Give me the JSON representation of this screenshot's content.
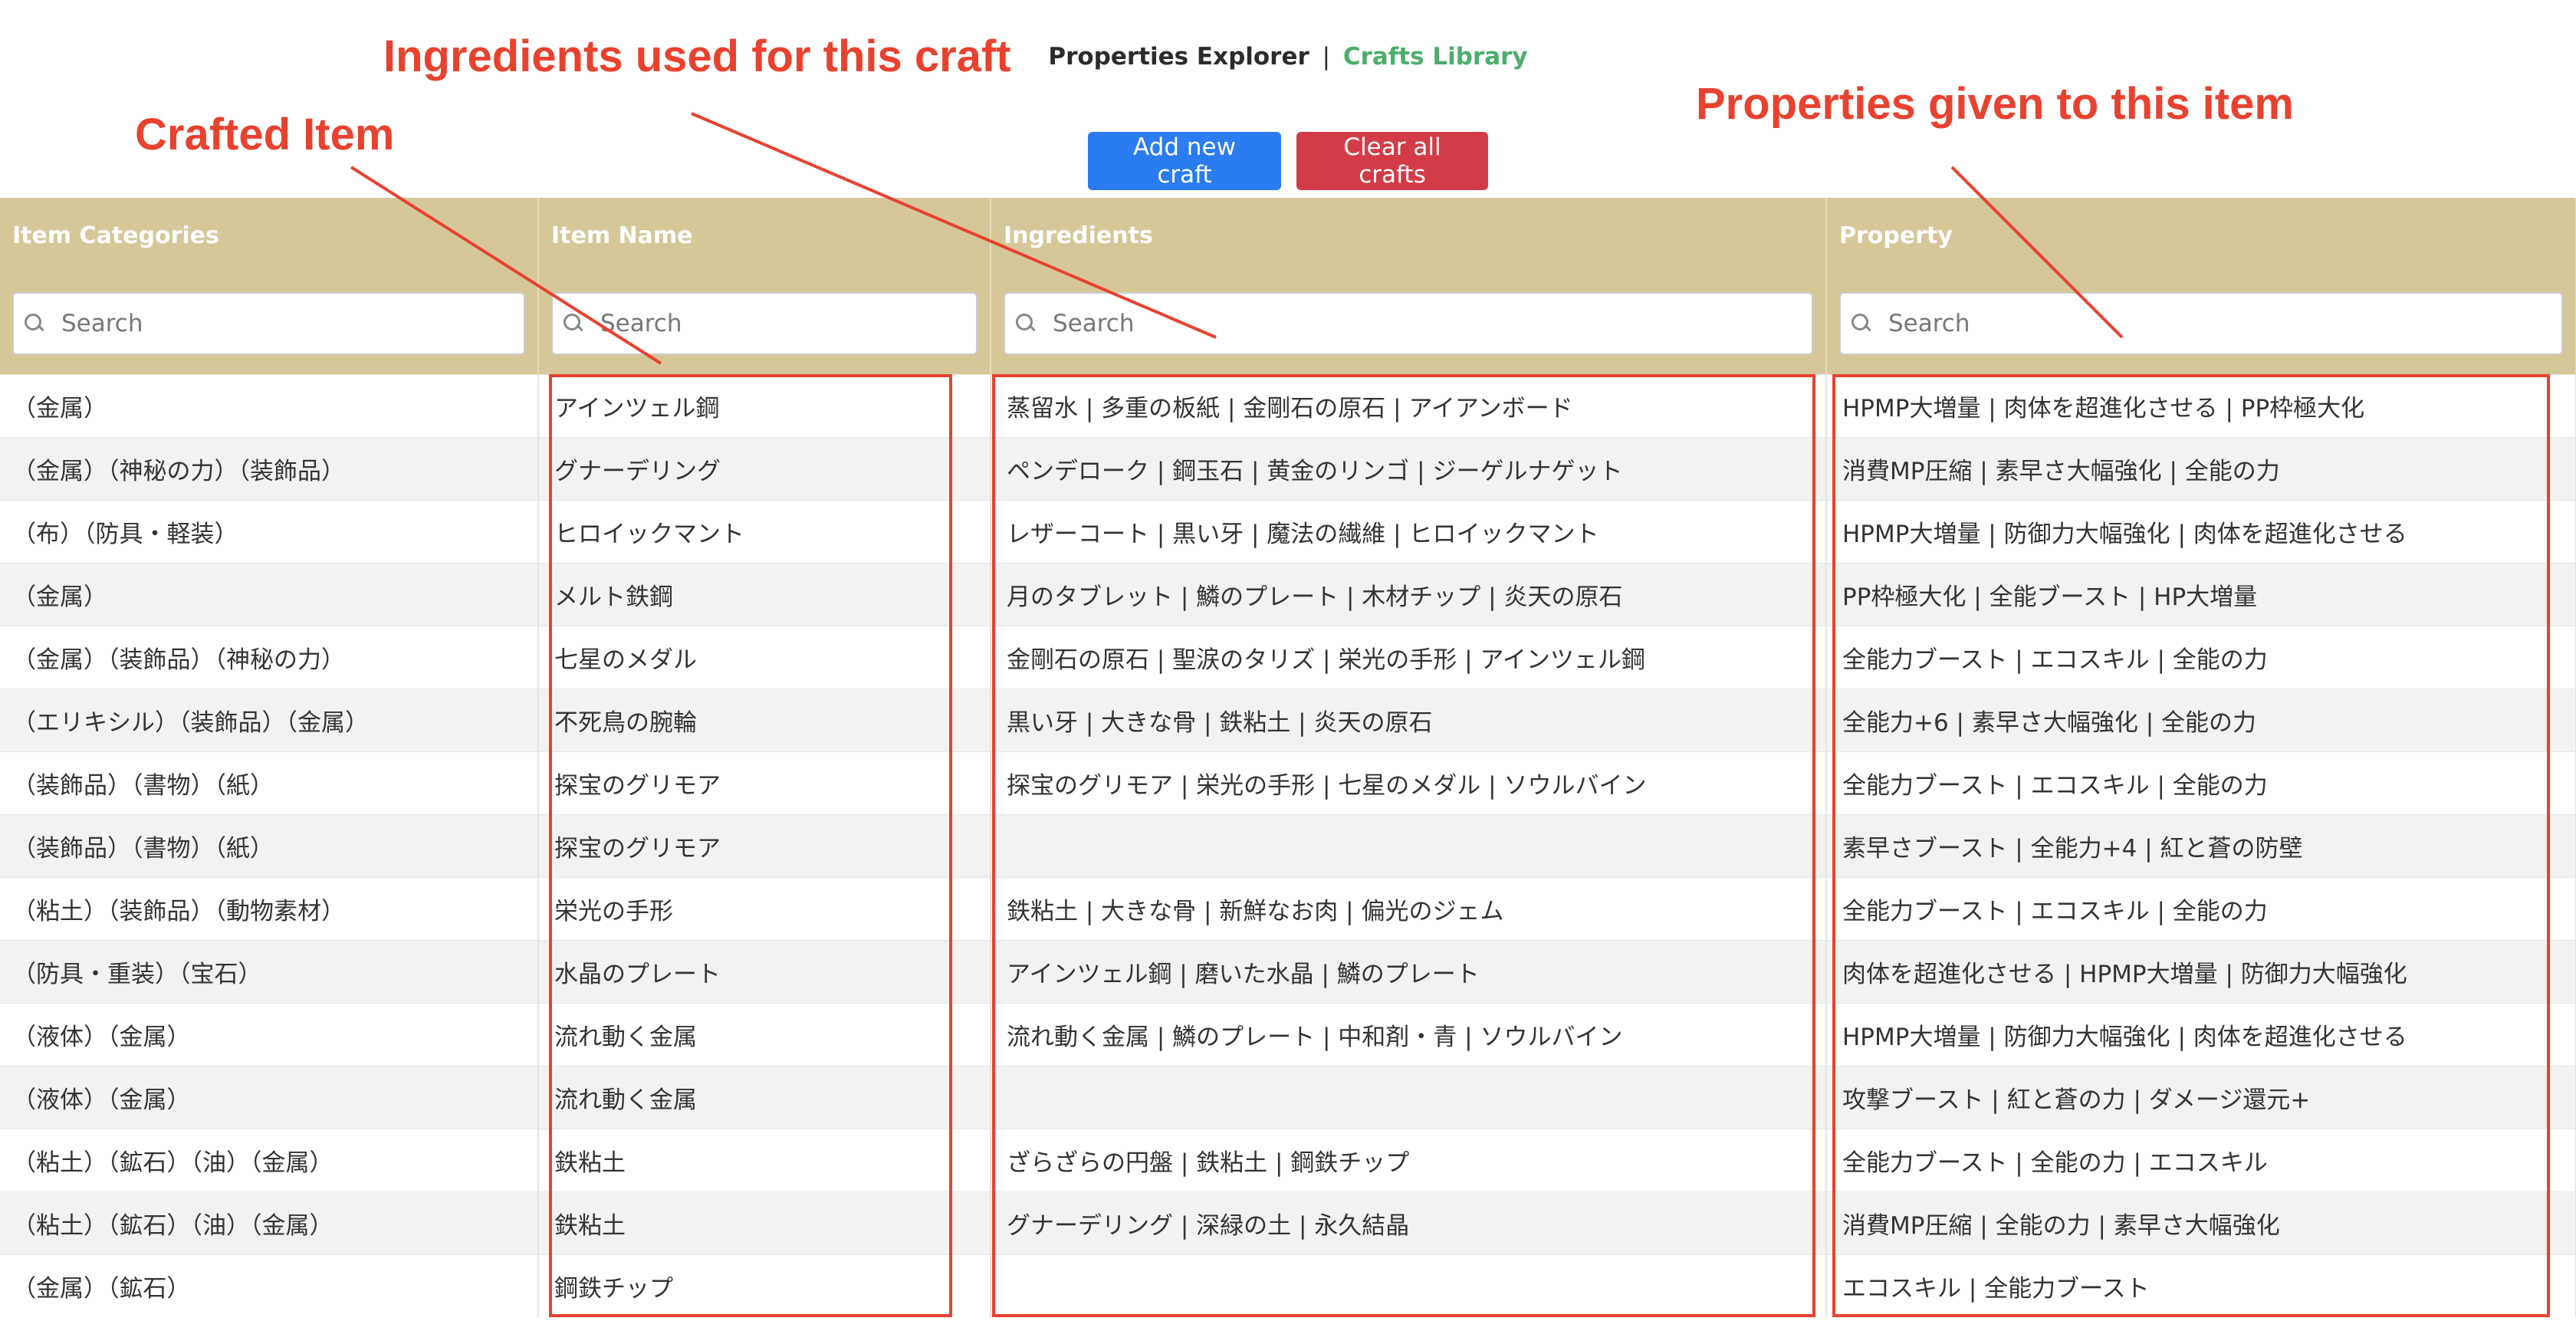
{
  "nav": {
    "active": "Properties Explorer",
    "separator": "|",
    "link": "Crafts Library"
  },
  "buttons": {
    "add": "Add new craft",
    "clear": "Clear all crafts"
  },
  "colors": {
    "header_bg": "#d6c799",
    "primary": "#2a7cf0",
    "danger": "#d33c47",
    "annotation": "#e8422f",
    "link": "#4cae6c"
  },
  "table": {
    "headers": [
      "Item Categories",
      "Item Name",
      "Ingredients",
      "Property"
    ],
    "search_placeholder": "Search",
    "rows": [
      [
        "（金属）",
        "アインツェル鋼",
        "蒸留水 | 多重の板紙 | 金剛石の原石 | アイアンボード",
        "HPMP大増量 | 肉体を超進化させる | PP枠極大化"
      ],
      [
        "（金属）（神秘の力）（装飾品）",
        "グナーデリング",
        "ペンデローク | 鋼玉石 | 黄金のリンゴ | ジーゲルナゲット",
        "消費MP圧縮 | 素早さ大幅強化 | 全能の力"
      ],
      [
        "（布）（防具・軽装）",
        "ヒロイックマント",
        "レザーコート | 黒い牙 | 魔法の繊維 | ヒロイックマント",
        "HPMP大増量 | 防御力大幅強化 | 肉体を超進化させる"
      ],
      [
        "（金属）",
        "メルト鉄鋼",
        "月のタブレット | 鱗のプレート | 木材チップ | 炎天の原石",
        "PP枠極大化 | 全能ブースト | HP大増量"
      ],
      [
        "（金属）（装飾品）（神秘の力）",
        "七星のメダル",
        "金剛石の原石 | 聖涙のタリズ | 栄光の手形 | アインツェル鋼",
        "全能力ブースト | エコスキル | 全能の力"
      ],
      [
        "（エリキシル）（装飾品）（金属）",
        "不死鳥の腕輪",
        "黒い牙 | 大きな骨 | 鉄粘土 | 炎天の原石",
        "全能力+6 | 素早さ大幅強化 | 全能の力"
      ],
      [
        "（装飾品）（書物）（紙）",
        "探宝のグリモア",
        "探宝のグリモア | 栄光の手形 | 七星のメダル | ソウルバイン",
        "全能力ブースト | エコスキル | 全能の力"
      ],
      [
        "（装飾品）（書物）（紙）",
        "探宝のグリモア",
        "",
        "素早さブースト | 全能力+4 | 紅と蒼の防壁"
      ],
      [
        "（粘土）（装飾品）（動物素材）",
        "栄光の手形",
        "鉄粘土 | 大きな骨 | 新鮮なお肉 | 偏光のジェム",
        "全能力ブースト | エコスキル | 全能の力"
      ],
      [
        "（防具・重装）（宝石）",
        "水晶のプレート",
        "アインツェル鋼 | 磨いた水晶 | 鱗のプレート",
        "肉体を超進化させる | HPMP大増量 | 防御力大幅強化"
      ],
      [
        "（液体）（金属）",
        "流れ動く金属",
        "流れ動く金属 | 鱗のプレート | 中和剤・青 | ソウルバイン",
        "HPMP大増量 | 防御力大幅強化 | 肉体を超進化させる"
      ],
      [
        "（液体）（金属）",
        "流れ動く金属",
        "",
        "攻撃ブースト | 紅と蒼の力 | ダメージ還元+"
      ],
      [
        "（粘土）（鉱石）（油）（金属）",
        "鉄粘土",
        "ざらざらの円盤 | 鉄粘土 | 鋼鉄チップ",
        "全能力ブースト | 全能の力 | エコスキル"
      ],
      [
        "（粘土）（鉱石）（油）（金属）",
        "鉄粘土",
        "グナーデリング | 深緑の土 | 永久結晶",
        "消費MP圧縮 | 全能の力 | 素早さ大幅強化"
      ],
      [
        "（金属）（鉱石）",
        "鋼鉄チップ",
        "",
        "エコスキル | 全能力ブースト"
      ]
    ]
  },
  "annotations": {
    "crafted_item": "Crafted Item",
    "ingredients": "Ingredients used for this craft",
    "properties": "Properties given to this item"
  }
}
